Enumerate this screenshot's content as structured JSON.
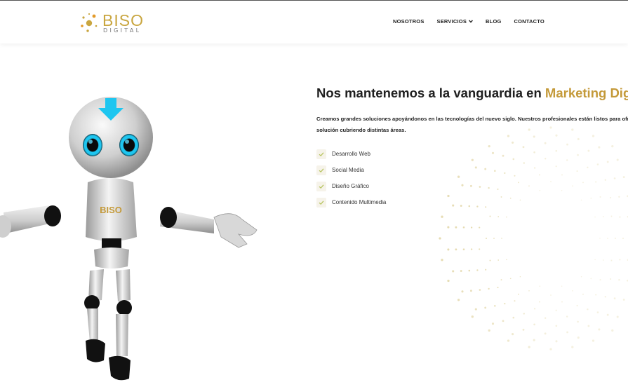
{
  "header": {
    "logo": {
      "word": "BISO",
      "sub": "DIGITAL"
    },
    "nav": [
      {
        "label": "NOSOTROS",
        "has_dropdown": false
      },
      {
        "label": "SERVICIOS",
        "has_dropdown": true
      },
      {
        "label": "BLOG",
        "has_dropdown": false
      },
      {
        "label": "CONTACTO",
        "has_dropdown": false
      }
    ]
  },
  "hero": {
    "robot_chest_text": "BISO",
    "title_prefix": "Nos mantenemos a la vanguardia en ",
    "title_accent": "Marketing Digital",
    "description_line1": "Creamos grandes soluciones apoyándonos en las tecnologías del nuevo siglo. Nuestros profesionales están listos para ofrecerte",
    "description_line2": "solución cubriendo distintas áreas.",
    "features": [
      {
        "label": "Desarrollo Web"
      },
      {
        "label": "Social Media"
      },
      {
        "label": "Diseño Gráfico"
      },
      {
        "label": "Contenido Multimedia"
      }
    ]
  },
  "colors": {
    "accent": "#c49a3a",
    "logo_gold": "#c9a640",
    "robot_eye": "#1ec6f0",
    "check": "#b4c25a"
  }
}
